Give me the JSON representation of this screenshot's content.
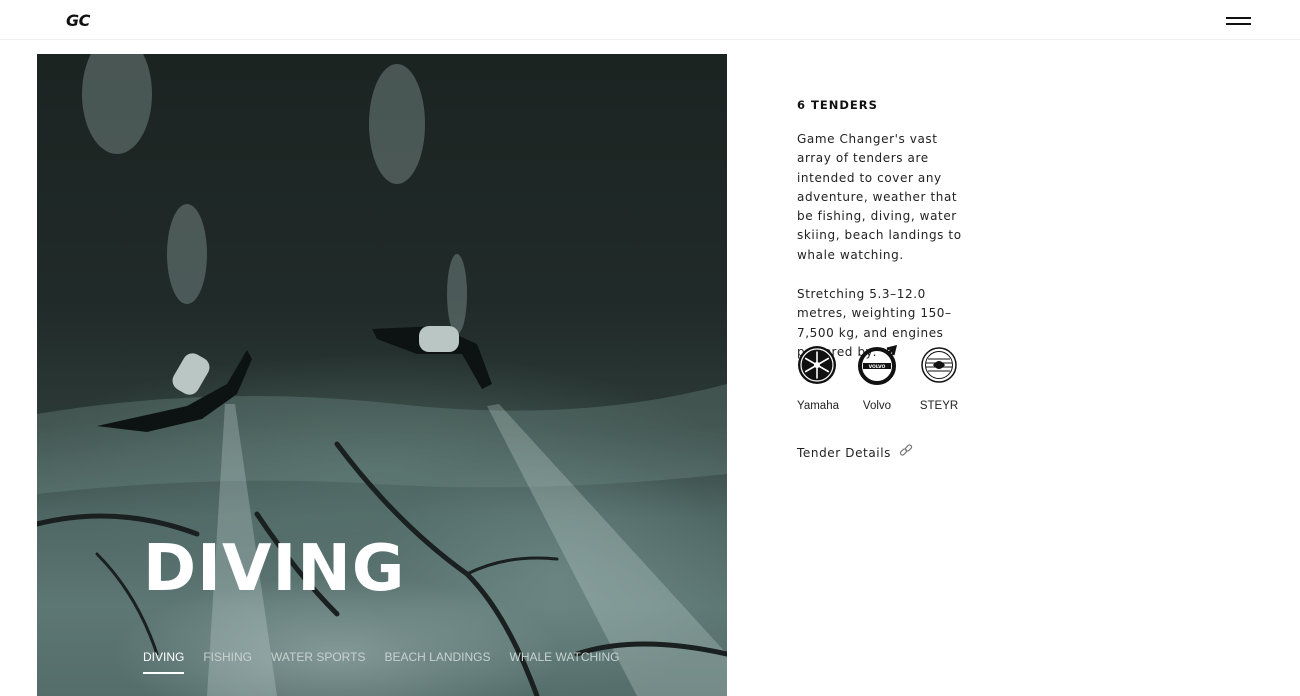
{
  "header": {
    "logo": "GC"
  },
  "hero": {
    "title": "DIVING",
    "tabs": [
      {
        "label": "DIVING",
        "active": true
      },
      {
        "label": "FISHING",
        "active": false
      },
      {
        "label": "WATER SPORTS",
        "active": false
      },
      {
        "label": "BEACH LANDINGS",
        "active": false
      },
      {
        "label": "WHALE WATCHING",
        "active": false
      }
    ]
  },
  "info": {
    "count": "6 TENDERS",
    "paragraph1": "Game Changer's vast array of tenders are intended to cover any adventure, weather that be fishing, diving, water skiing, beach landings to whale watching.",
    "paragraph2": "Stretching 5.3–12.0 metres, weighting 150–7,500 kg, and engines powered by:",
    "engines": [
      {
        "label": "Yamaha",
        "icon": "yamaha-logo-icon"
      },
      {
        "label": "Volvo",
        "icon": "volvo-logo-icon"
      },
      {
        "label": "STEYR",
        "icon": "steyr-logo-icon"
      }
    ],
    "details_link": "Tender Details",
    "details_icon": "link-icon"
  }
}
